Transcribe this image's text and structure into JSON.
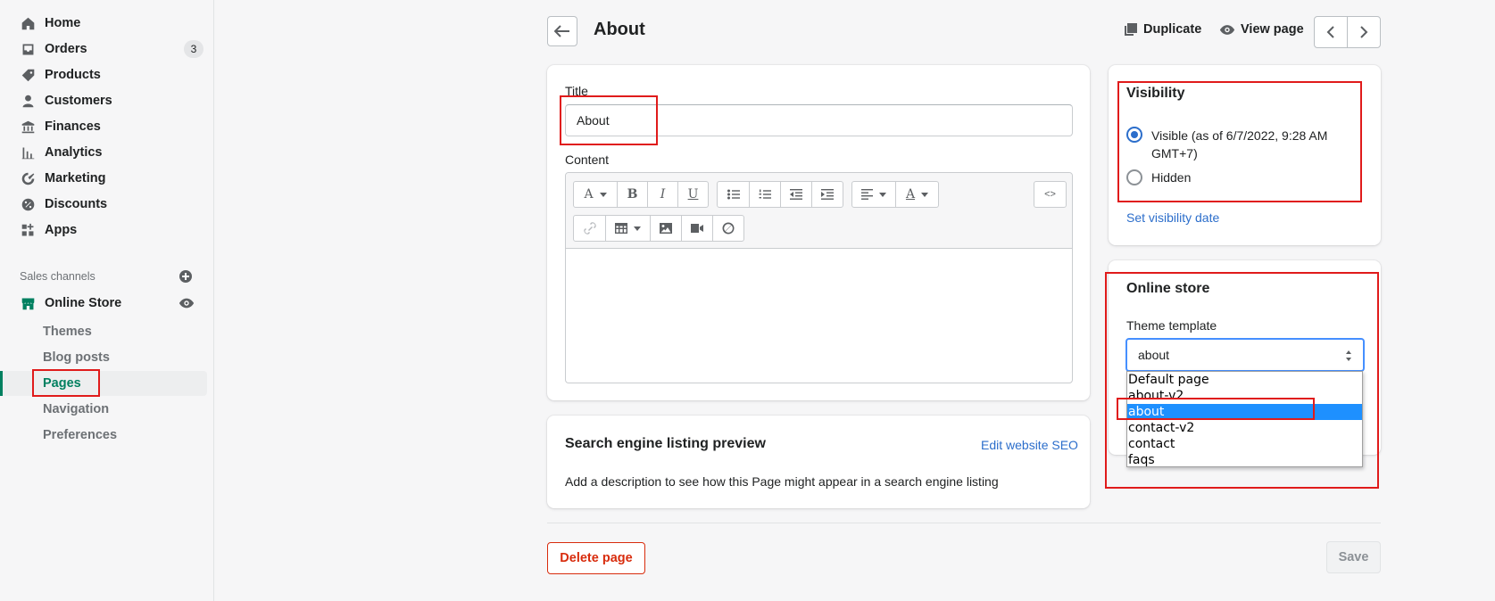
{
  "sidebar": {
    "items": [
      {
        "label": "Home"
      },
      {
        "label": "Orders",
        "badge": "3"
      },
      {
        "label": "Products"
      },
      {
        "label": "Customers"
      },
      {
        "label": "Finances"
      },
      {
        "label": "Analytics"
      },
      {
        "label": "Marketing"
      },
      {
        "label": "Discounts"
      },
      {
        "label": "Apps"
      }
    ],
    "sales_channels_label": "Sales channels",
    "online_store_label": "Online Store",
    "sub_items": [
      {
        "label": "Themes"
      },
      {
        "label": "Blog posts"
      },
      {
        "label": "Pages"
      },
      {
        "label": "Navigation"
      },
      {
        "label": "Preferences"
      }
    ]
  },
  "header": {
    "title": "About",
    "duplicate_label": "Duplicate",
    "view_page_label": "View page"
  },
  "main": {
    "title_label": "Title",
    "title_value": "About",
    "content_label": "Content",
    "toolbar": {
      "code_label": "<>"
    },
    "seo": {
      "heading": "Search engine listing preview",
      "edit_link": "Edit website SEO",
      "description": "Add a description to see how this Page might appear in a search engine listing"
    }
  },
  "visibility": {
    "heading": "Visibility",
    "visible_label_line1": "Visible (as of 6/7/2022, 9:28 AM",
    "visible_label_line2": "GMT+7)",
    "hidden_label": "Hidden",
    "set_date_link": "Set visibility date",
    "selected": "visible"
  },
  "online_store": {
    "heading": "Online store",
    "template_label": "Theme template",
    "selected_value": "about",
    "options": [
      "Default page",
      "about-v2",
      "about",
      "contact-v2",
      "contact",
      "faqs"
    ]
  },
  "footer": {
    "delete_label": "Delete page",
    "save_label": "Save"
  },
  "colors": {
    "accent_green": "#008060",
    "link_blue": "#2c6ecb",
    "danger_red": "#d82c0d",
    "highlight_red": "#e01b1b"
  }
}
